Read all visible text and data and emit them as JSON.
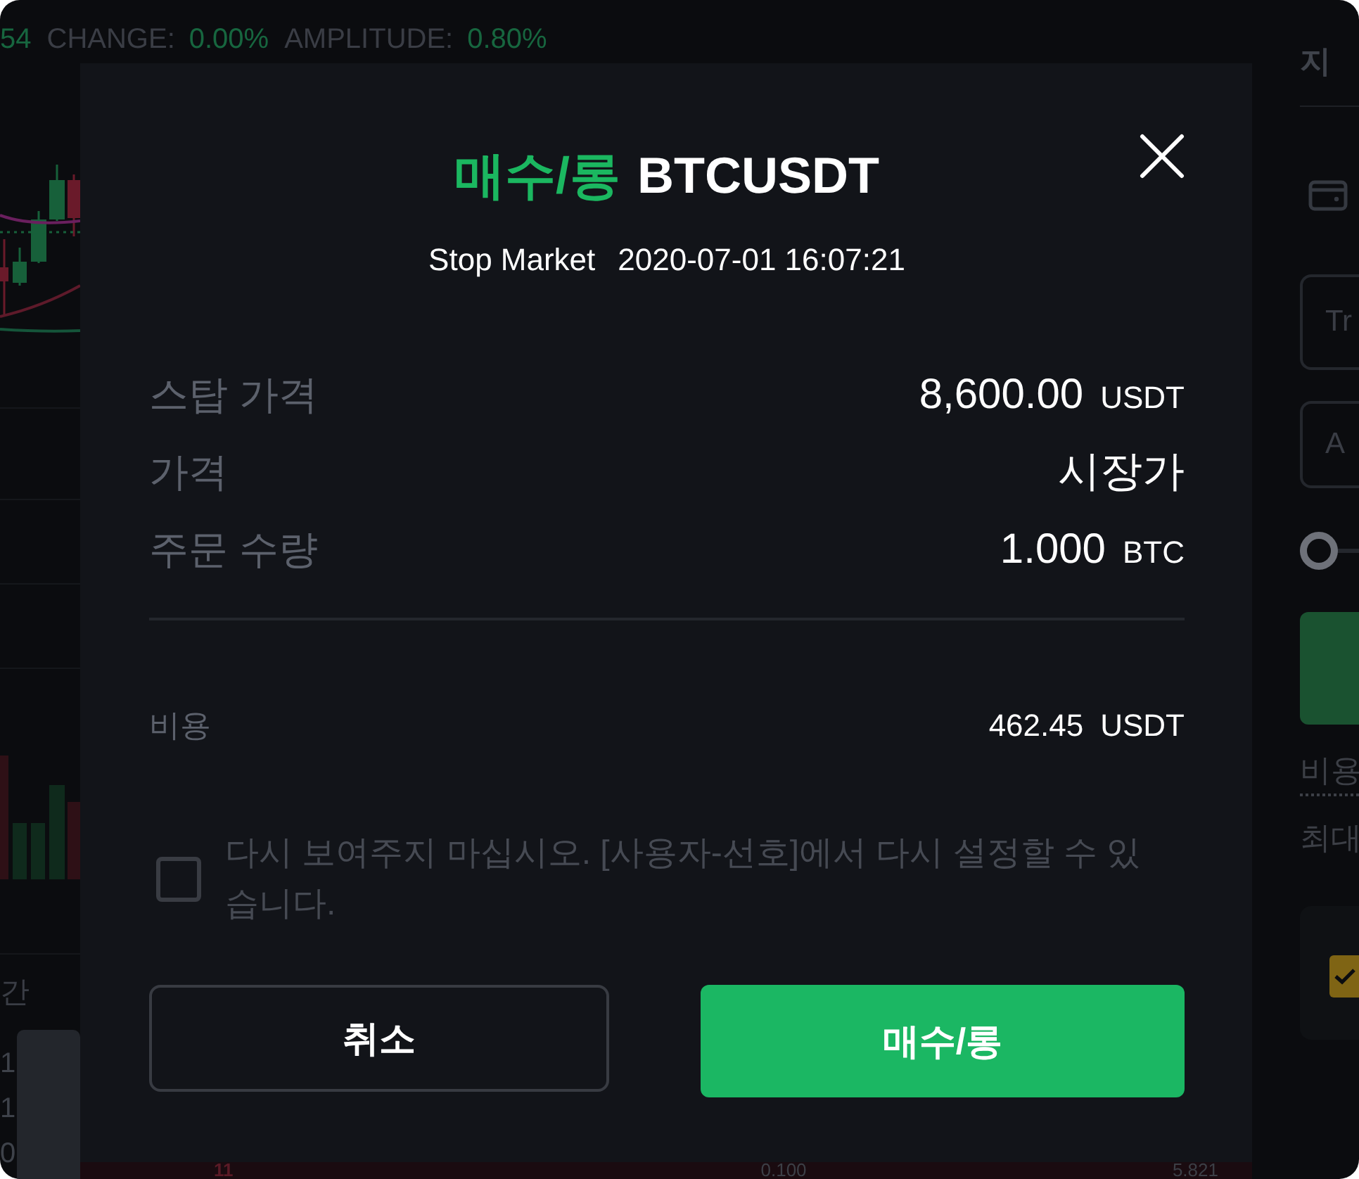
{
  "top_bar": {
    "leading_value": "54",
    "stats": [
      {
        "label": "CHANGE:",
        "value": "0.00%"
      },
      {
        "label": "AMPLITUDE:",
        "value": "0.80%"
      }
    ]
  },
  "left_panel": {
    "label": "간",
    "rows": [
      "1",
      "1",
      "0"
    ]
  },
  "dialog": {
    "side": "매수/롱",
    "symbol": "BTCUSDT",
    "order_type": "Stop Market",
    "timestamp": "2020-07-01 16:07:21",
    "details": [
      {
        "label": "스탑 가격",
        "value": "8,600.00",
        "unit": "USDT"
      },
      {
        "label": "가격",
        "value": "시장가"
      },
      {
        "label": "주문 수량",
        "value": "1.000",
        "unit": "BTC"
      }
    ],
    "cost": {
      "label": "비용",
      "value": "462.45",
      "unit": "USDT"
    },
    "dont_show_again": {
      "checked": false,
      "text": "다시 보여주지 마십시오. [사용자-선호]에서 다시 설정할 수 있습니다."
    },
    "buttons": [
      {
        "label": "취소",
        "kind": "secondary"
      },
      {
        "label": "매수/롱",
        "kind": "primary"
      }
    ]
  },
  "order_row": {
    "cells": [
      {
        "text": "11",
        "kind": "sell"
      },
      {
        "text": "0.100",
        "kind": "plain"
      },
      {
        "text": "5.821",
        "kind": "plain"
      }
    ]
  },
  "right_panel": {
    "title": "지",
    "fields": [
      {
        "placeholder": "Tr"
      },
      {
        "placeholder": "A"
      }
    ],
    "slider": {
      "level": 0
    },
    "labels": [
      "비용",
      "최대"
    ],
    "checkbox": {
      "checked": true
    }
  }
}
